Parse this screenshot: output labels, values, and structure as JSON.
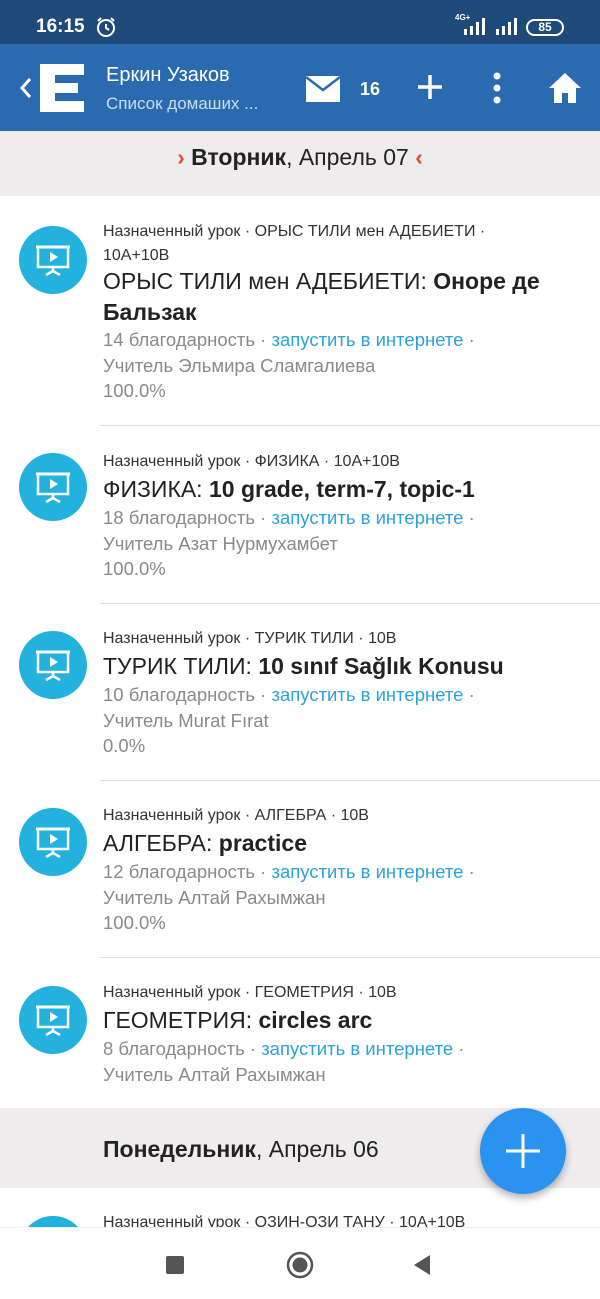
{
  "status_bar": {
    "time": "16:15",
    "network": "4G+",
    "battery": "85"
  },
  "app_bar": {
    "user_name": "Еркин Узаков",
    "subtitle": "Список домаших ...",
    "mail_count": "16"
  },
  "sections": [
    {
      "day": "Вторник",
      "date": ", Апрель 07",
      "prev_arrow": "›",
      "next_arrow": "‹"
    },
    {
      "day": "Понедельник",
      "date": ", Апрель 06"
    }
  ],
  "items": [
    {
      "meta": "Назначенный урок · ОРЫС ТИЛИ мен АДЕБИЕТИ ·",
      "meta2": "10А+10В",
      "subject": "ОРЫС ТИЛИ мен АДЕБИЕТИ: ",
      "topic": "Оноре де Бальзак",
      "thanks": "14 благодарность",
      "launch": "запустить в интернете",
      "teacher": "Учитель Эльмира Сламгалиева",
      "progress": "100.0%"
    },
    {
      "meta": "Назначенный урок · ФИЗИКА · 10А+10В",
      "subject": "ФИЗИКА: ",
      "topic": "10 grade, term-7, topic-1",
      "thanks": "18 благодарность",
      "launch": "запустить в интернете",
      "teacher": "Учитель Азат Нурмухамбет",
      "progress": "100.0%"
    },
    {
      "meta": "Назначенный урок · ТУРИК ТИЛИ · 10В",
      "subject": "ТУРИК ТИЛИ: ",
      "topic": "10 sınıf Sağlık Konusu",
      "thanks": "10 благодарность",
      "launch": "запустить в интернете",
      "teacher": "Учитель Murat Fırat",
      "progress": "0.0%"
    },
    {
      "meta": "Назначенный урок · АЛГЕБРА · 10В",
      "subject": "АЛГЕБРА: ",
      "topic": "practice",
      "thanks": "12 благодарность",
      "launch": "запустить в интернете",
      "teacher": "Учитель Алтай Рахымжан",
      "progress": "100.0%"
    },
    {
      "meta": "Назначенный урок · ГЕОМЕТРИЯ · 10В",
      "subject": "ГЕОМЕТРИЯ: ",
      "topic": "circles arc",
      "thanks": "8 благодарность",
      "launch": "запустить в интернете",
      "teacher": "Учитель Алтай Рахымжан"
    },
    {
      "meta": "Назначенный урок · ОЗИН-ОЗИ ТАНУ · 10А+10В"
    }
  ],
  "separator": " · ",
  "colors": {
    "app_bar": "#2a6bb0",
    "status_bar": "#1e4a7a",
    "accent_link": "#2ba3da",
    "icon_bg": "#22b2dd",
    "fab": "#2a93f0",
    "arrow": "#e84a2a"
  },
  "icons": [
    "alarm-icon",
    "signal-icon",
    "battery-icon",
    "back-chevron-icon",
    "app-logo-icon",
    "mail-icon",
    "plus-icon",
    "more-vert-icon",
    "home-icon",
    "presentation-icon",
    "add-icon"
  ]
}
